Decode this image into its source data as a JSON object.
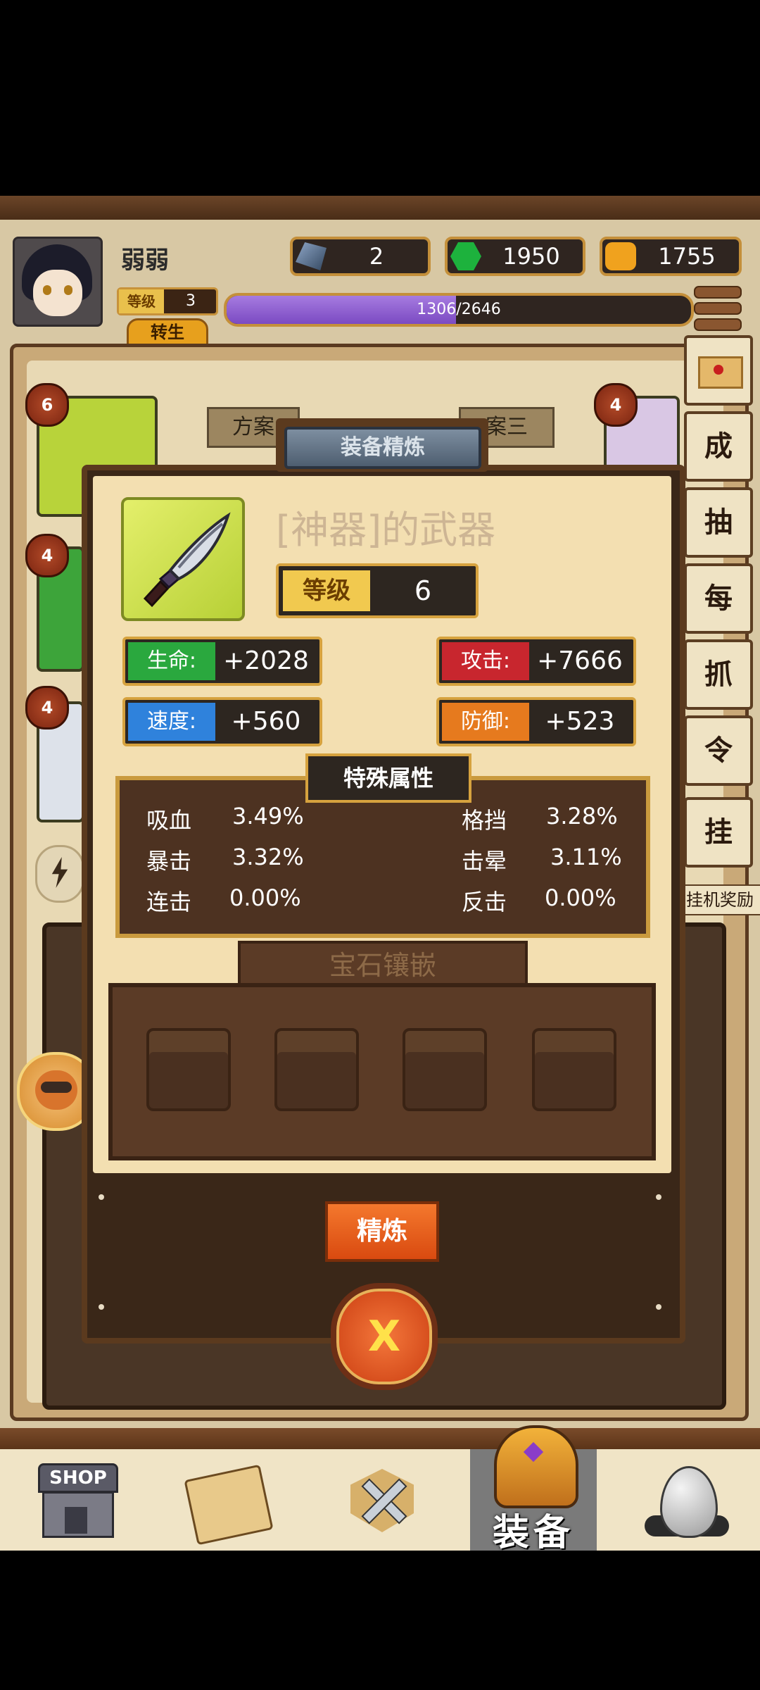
{
  "player": {
    "name": "弱弱",
    "level_label": "等级",
    "level": "3",
    "rebirth_label": "转生"
  },
  "resources": [
    {
      "icon": "crystal-icon",
      "value": "2"
    },
    {
      "icon": "emerald-icon",
      "value": "1950"
    },
    {
      "icon": "coin-icon",
      "value": "1755"
    }
  ],
  "xp": {
    "text": "1306/2646",
    "fraction": 0.4935
  },
  "background": {
    "tabs": [
      "方案",
      "案三"
    ],
    "slot_levels": [
      "6",
      "4",
      "4",
      "4"
    ]
  },
  "side_menu": {
    "items": [
      "成",
      "抽",
      "每",
      "抓",
      "令",
      "挂"
    ],
    "afk_label": "挂机奖励"
  },
  "popup": {
    "title": "装备精炼",
    "item_name": "[神器]的武器",
    "level_label": "等级",
    "level_value": "6",
    "stats": {
      "hp": {
        "label": "生命:",
        "value": "+2028",
        "color": "#2aa83e"
      },
      "atk": {
        "label": "攻击:",
        "value": "+7666",
        "color": "#c8262e"
      },
      "spd": {
        "label": "速度:",
        "value": "+560",
        "color": "#2f82dc"
      },
      "def": {
        "label": "防御:",
        "value": "+523",
        "color": "#e67a1e"
      }
    },
    "special_title": "特殊属性",
    "special": [
      {
        "name": "吸血",
        "value": "3.49%"
      },
      {
        "name": "格挡",
        "value": "3.28%"
      },
      {
        "name": "暴击",
        "value": "3.32%"
      },
      {
        "name": "击晕",
        "value": "3.11%"
      },
      {
        "name": "连击",
        "value": "0.00%"
      },
      {
        "name": "反击",
        "value": "0.00%"
      }
    ],
    "gem_title": "宝石镶嵌",
    "refine_label": "精炼",
    "close_label": "X"
  },
  "nav": {
    "shop_label": "SHOP",
    "equip_label": "装备",
    "items": [
      "shop-icon",
      "map-icon",
      "battle-icon",
      "helmet-icon",
      "egg-icon"
    ]
  }
}
